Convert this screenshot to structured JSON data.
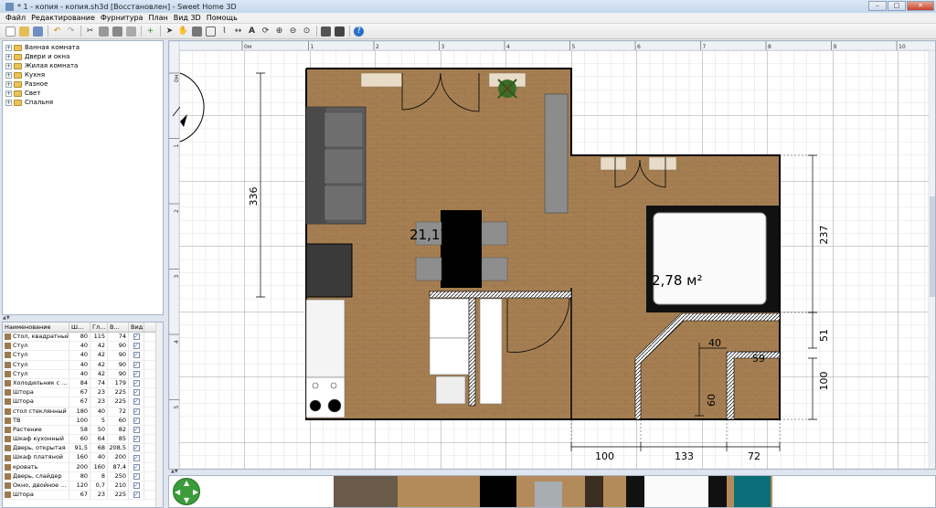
{
  "window": {
    "title": "* 1 - копия - копия.sh3d [Восстановлен] - Sweet Home 3D",
    "minimize": "–",
    "maximize": "□",
    "close": "✕"
  },
  "menu": [
    "Файл",
    "Редактирование",
    "Фурнитура",
    "План",
    "Вид 3D",
    "Помощь"
  ],
  "toolbar": {
    "icons": [
      "new-file",
      "open-file",
      "save-file",
      "cut",
      "copy",
      "paste",
      "undo",
      "redo",
      "cut-tool",
      "copy-tool",
      "paste-tool",
      "delete",
      "select-mode",
      "pan-mode",
      "create-walls",
      "create-rooms",
      "create-polylines",
      "create-dimensions",
      "create-labels",
      "rotate",
      "zoom-in",
      "zoom-out",
      "zoom-reset",
      "create-photo",
      "create-video",
      "help"
    ]
  },
  "catalog": {
    "categories": [
      "Ванная комната",
      "Двери и окна",
      "Жилая комната",
      "Кухня",
      "Разное",
      "Свет",
      "Спальня"
    ]
  },
  "furniture_table": {
    "headers": [
      "Наименование",
      "Ш...",
      "Гл...",
      "В...",
      "Вид..."
    ],
    "rows": [
      {
        "name": "Стол, квадратный",
        "w": "80",
        "d": "115",
        "h": "74",
        "visible": true
      },
      {
        "name": "Стул",
        "w": "40",
        "d": "42",
        "h": "90",
        "visible": true
      },
      {
        "name": "Стул",
        "w": "40",
        "d": "42",
        "h": "90",
        "visible": true
      },
      {
        "name": "Стул",
        "w": "40",
        "d": "42",
        "h": "90",
        "visible": true
      },
      {
        "name": "Стул",
        "w": "40",
        "d": "42",
        "h": "90",
        "visible": true
      },
      {
        "name": "Холодильник с ...",
        "w": "84",
        "d": "74",
        "h": "179",
        "visible": true
      },
      {
        "name": "Штора",
        "w": "67",
        "d": "23",
        "h": "225",
        "visible": true
      },
      {
        "name": "Штора",
        "w": "67",
        "d": "23",
        "h": "225",
        "visible": true
      },
      {
        "name": "стол стеклянный",
        "w": "180",
        "d": "40",
        "h": "72",
        "visible": true
      },
      {
        "name": "ТВ",
        "w": "100",
        "d": "5",
        "h": "60",
        "visible": true
      },
      {
        "name": "Растение",
        "w": "58",
        "d": "50",
        "h": "82",
        "visible": true
      },
      {
        "name": "Шкаф кухонный",
        "w": "60",
        "d": "64",
        "h": "85",
        "visible": true
      },
      {
        "name": "Дверь, открытая",
        "w": "91,5",
        "d": "68",
        "h": "208,5",
        "visible": true
      },
      {
        "name": "Шкаф платяной",
        "w": "160",
        "d": "40",
        "h": "200",
        "visible": true
      },
      {
        "name": "кровать",
        "w": "200",
        "d": "160",
        "h": "87,4",
        "visible": true
      },
      {
        "name": "Дверь, слайдер",
        "w": "80",
        "d": "8",
        "h": "250",
        "visible": true
      },
      {
        "name": "Окно, двойное ...",
        "w": "120",
        "d": "0,7",
        "h": "210",
        "visible": true
      },
      {
        "name": "Штора",
        "w": "67",
        "d": "23",
        "h": "225",
        "visible": true
      }
    ]
  },
  "plan": {
    "ruler_top": [
      "0м",
      "1",
      "2",
      "3",
      "4",
      "5",
      "6",
      "7",
      "8",
      "9",
      "10"
    ],
    "ruler_left": [
      "0м",
      "1",
      "2",
      "3",
      "4",
      "5"
    ],
    "room_labels": [
      "21,17",
      "2,78 м²"
    ],
    "dimensions": [
      "336",
      "237",
      "51",
      "100",
      "40",
      "59",
      "60",
      "100",
      "133",
      "72"
    ]
  },
  "colors": {
    "floor": "#a57f52",
    "wall": "#000000",
    "grid": "#c9c9c9",
    "grid_major": "#8c8c8c",
    "sofa": "#6a6a6a",
    "bed_frame": "#111111"
  }
}
